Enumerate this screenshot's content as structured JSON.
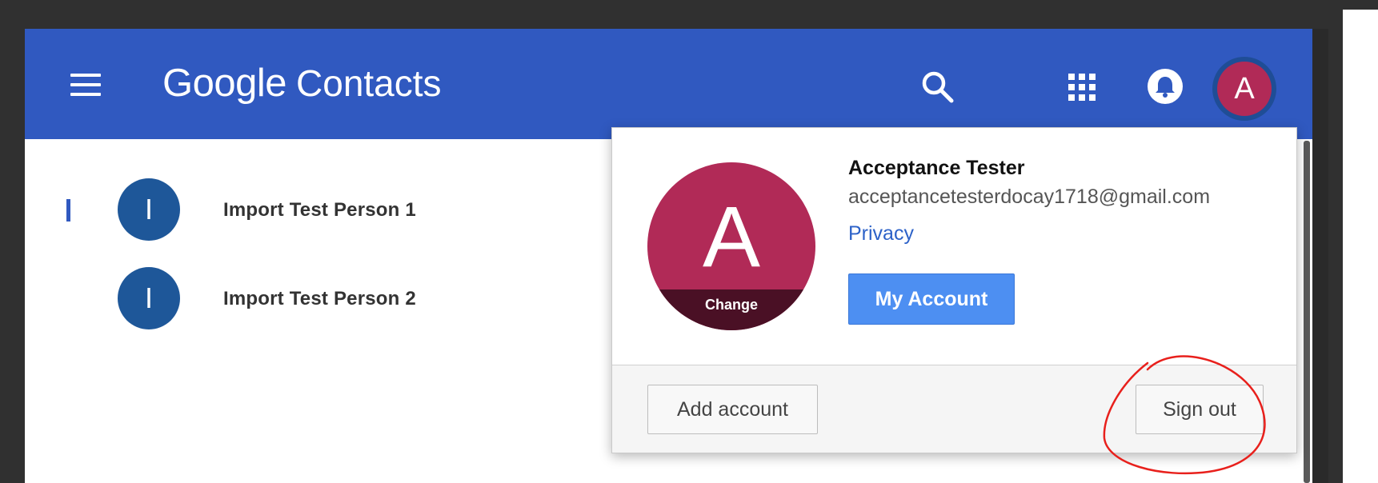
{
  "app": {
    "logo_google": "Google",
    "logo_product": "Contacts"
  },
  "header": {
    "menu_icon": "hamburger-menu-icon",
    "search_icon": "search-icon",
    "apps_icon": "apps-grid-icon",
    "notifications_icon": "notifications-bell-icon",
    "avatar_letter": "A"
  },
  "contacts": [
    {
      "initial": "I",
      "name": "Import Test Person 1",
      "selected": true
    },
    {
      "initial": "I",
      "name": "Import Test Person 2",
      "selected": false
    }
  ],
  "account_menu": {
    "avatar_letter": "A",
    "change_label": "Change",
    "name": "Acceptance Tester",
    "email": "acceptancetesterdocay1718@gmail.com",
    "privacy_label": "Privacy",
    "my_account_label": "My Account",
    "add_account_label": "Add account",
    "sign_out_label": "Sign out"
  },
  "colors": {
    "header_bg": "#3059c0",
    "avatar_bg": "#b12a57",
    "contact_avatar_bg": "#1e5799",
    "primary_button": "#4d8ff2",
    "link": "#2d62c8",
    "annotation": "#e8201c"
  }
}
